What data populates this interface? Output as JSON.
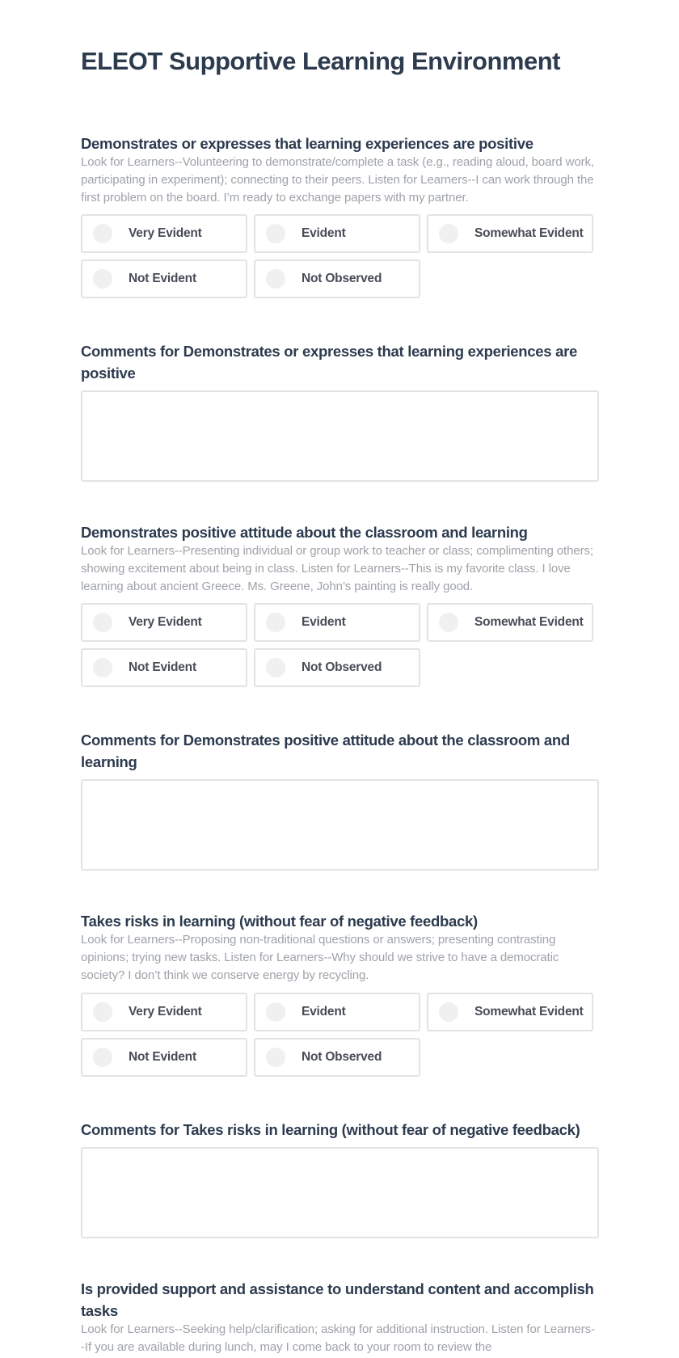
{
  "page": {
    "title": "ELEOT Supportive Learning Environment"
  },
  "rating_options": [
    "Very Evident",
    "Evident",
    "Somewhat Evident",
    "Not Evident",
    "Not Observed"
  ],
  "questions": [
    {
      "title": "Demonstrates or expresses that learning experiences are positive",
      "description": "Look for Learners--Volunteering to demonstrate/complete a task (e.g., reading aloud, board work, participating in experiment); connecting to their peers. Listen for Learners--I can work through the first problem on the board. I’m ready to exchange papers with my partner.",
      "options": [
        "Very Evident",
        "Evident",
        "Somewhat Evident",
        "Not Evident",
        "Not Observed"
      ],
      "selected": null,
      "comment_label": "Comments for Demonstrates or expresses that learning experiences are positive",
      "comment_value": ""
    },
    {
      "title": "Demonstrates positive attitude about the classroom and learning",
      "description": "Look for Learners--Presenting individual or group work to teacher or class; complimenting others; showing excitement about being in class. Listen for Learners--This is my favorite class. I love learning about ancient Greece. Ms. Greene, John’s painting is really good.",
      "options": [
        "Very Evident",
        "Evident",
        "Somewhat Evident",
        "Not Evident",
        "Not Observed"
      ],
      "selected": null,
      "comment_label": "Comments for Demonstrates positive attitude about the classroom and learning",
      "comment_value": ""
    },
    {
      "title": "Takes risks in learning (without fear of negative feedback)",
      "description": "Look for Learners--Proposing non-traditional questions or answers; presenting contrasting opinions; trying new tasks. Listen for Learners--Why should we strive to have a democratic society? I don’t think we conserve energy by recycling.",
      "options": [
        "Very Evident",
        "Evident",
        "Somewhat Evident",
        "Not Evident",
        "Not Observed"
      ],
      "selected": null,
      "comment_label": "Comments for Takes risks in learning (without fear of negative feedback)",
      "comment_value": ""
    },
    {
      "title": "Is provided support and assistance to understand content and accomplish tasks",
      "description": "Look for Learners--Seeking help/clarification; asking for additional instruction. Listen for Learners--If you are available during lunch, may I come back to your room to review the"
    }
  ]
}
